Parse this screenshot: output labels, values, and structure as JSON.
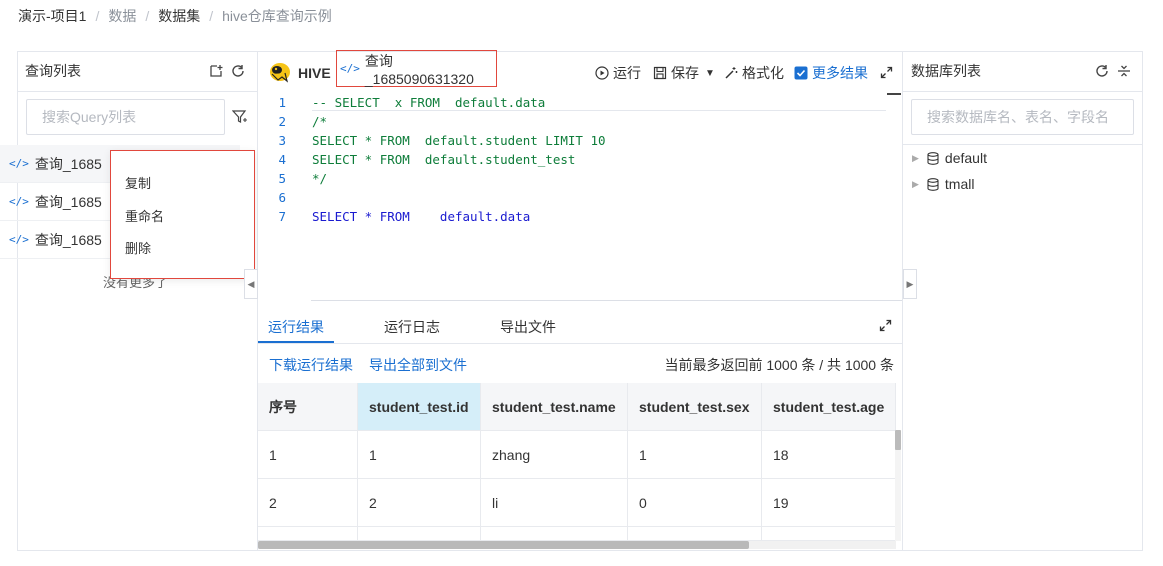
{
  "breadcrumb": {
    "project": "演示-项目1",
    "data": "数据",
    "dataset": "数据集",
    "page": "hive仓库查询示例",
    "separator": "/"
  },
  "query_panel": {
    "title": "查询列表",
    "search_placeholder": "搜索Query列表",
    "items": [
      {
        "label": "查询_1685"
      },
      {
        "label": "查询_1685"
      },
      {
        "label": "查询_1685"
      }
    ],
    "no_more": "没有更多了",
    "context_menu": [
      "复制",
      "重命名",
      "删除"
    ]
  },
  "editor_header": {
    "engine": "HIVE",
    "tab_label": "查询_1685090631320",
    "run": "运行",
    "save": "保存",
    "format": "格式化",
    "more_results": "更多结果",
    "more_results_checked": true
  },
  "editor": {
    "lines": [
      {
        "no": "1",
        "text": "-- SELECT  x FROM  default.data",
        "kind": "comment"
      },
      {
        "no": "2",
        "text": "/*",
        "kind": "comment"
      },
      {
        "no": "3",
        "text": "SELECT * FROM  default.student LIMIT 10",
        "kind": "comment"
      },
      {
        "no": "4",
        "text": "SELECT * FROM  default.student_test",
        "kind": "comment"
      },
      {
        "no": "5",
        "text": "*/",
        "kind": "comment"
      },
      {
        "no": "6",
        "text": "",
        "kind": "plain"
      },
      {
        "no": "7",
        "text": "SELECT * FROM    default.data",
        "kind": "code"
      }
    ]
  },
  "results": {
    "tabs": [
      "运行结果",
      "运行日志",
      "导出文件"
    ],
    "active_tab": "运行结果",
    "download_link": "下载运行结果",
    "export_link": "导出全部到文件",
    "summary": "当前最多返回前 1000 条 / 共 1000 条",
    "columns": [
      "序号",
      "student_test.id",
      "student_test.name",
      "student_test.sex",
      "student_test.age"
    ],
    "rows": [
      [
        "1",
        "1",
        "zhang",
        "1",
        "18"
      ],
      [
        "2",
        "2",
        "li",
        "0",
        "19"
      ],
      [
        "",
        "",
        "",
        "",
        ""
      ]
    ]
  },
  "db_panel": {
    "title": "数据库列表",
    "search_placeholder": "搜索数据库名、表名、字段名",
    "databases": [
      "default",
      "tmall"
    ]
  },
  "colors": {
    "accent": "#1a6fd1",
    "highlight_border": "#e1473d",
    "highlight_column": "#d5eef9"
  }
}
